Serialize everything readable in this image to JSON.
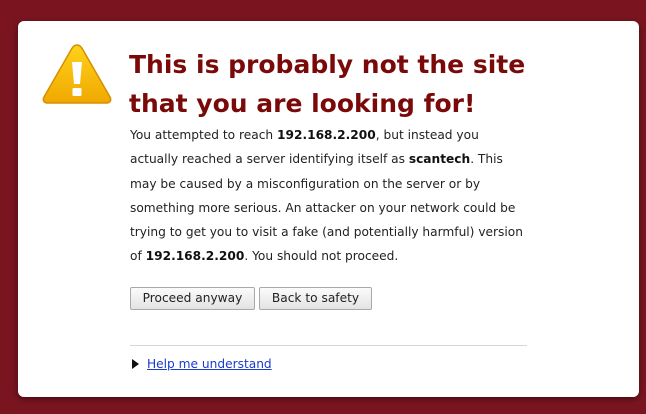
{
  "interstitial": {
    "title_line1": "This is probably not the site",
    "title_line2": "that you are looking for!",
    "description": {
      "t1": "You attempted to reach ",
      "host1": "192.168.2.200",
      "t2": ", but instead you actually reached a server identifying itself as ",
      "server": "scantech",
      "t3": ". This may be caused by a misconfiguration on the server or by something more serious. An attacker on your network could be trying to get you to visit a fake (and potentially harmful) version of ",
      "host2": "192.168.2.200",
      "t4": ". You should not proceed."
    },
    "buttons": {
      "proceed": "Proceed anyway",
      "back": "Back to safety"
    },
    "help_link": "Help me understand",
    "icon": "warning-triangle",
    "colors": {
      "page_background": "#7a1520",
      "title": "#7a0a0a",
      "warning_icon": "#f5b400",
      "link": "#1a3ad0"
    }
  }
}
